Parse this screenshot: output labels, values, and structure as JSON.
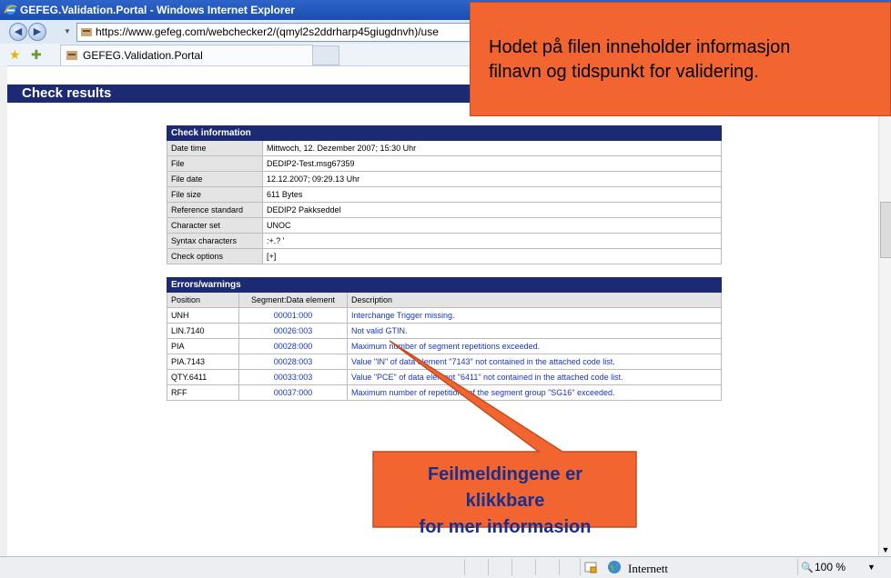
{
  "window": {
    "title": "GEFEG.Validation.Portal - Windows Internet Explorer"
  },
  "address": {
    "url": "https://www.gefeg.com/webchecker2/(qmyl2s2ddrharp45giugdnvh)/use"
  },
  "tab": {
    "label": "GEFEG.Validation.Portal"
  },
  "page": {
    "heading": "Check results"
  },
  "check_info": {
    "caption": "Check information",
    "rows": [
      {
        "label": "Date time",
        "value": "Mittwoch, 12. Dezember 2007; 15:30 Uhr"
      },
      {
        "label": "File",
        "value": "DEDIP2-Test.msg67359"
      },
      {
        "label": "File date",
        "value": "12.12.2007; 09:29.13 Uhr"
      },
      {
        "label": "File size",
        "value": "611 Bytes"
      },
      {
        "label": "Reference standard",
        "value": "DEDIP2 Pakkseddel"
      },
      {
        "label": "Character set",
        "value": "UNOC"
      },
      {
        "label": "Syntax characters",
        "value": ":+.? '"
      },
      {
        "label": "Check options",
        "value": "[+]"
      }
    ]
  },
  "errors": {
    "caption": "Errors/warnings",
    "headers": {
      "position": "Position",
      "segment": "Segment:Data element",
      "description": "Description"
    },
    "rows": [
      {
        "position": "UNH",
        "segment": "00001:000",
        "description": "Interchange Trigger missing."
      },
      {
        "position": "LIN.7140",
        "segment": "00026:003",
        "description": "Not valid GTIN."
      },
      {
        "position": "PIA",
        "segment": "00028:000",
        "description": "Maximum number of segment repetitions exceeded."
      },
      {
        "position": "PIA.7143",
        "segment": "00028:003",
        "description": "Value \"IN\" of data element \"7143\" not contained in the attached code list."
      },
      {
        "position": "QTY.6411",
        "segment": "00033:003",
        "description": "Value \"PCE\" of data element \"6411\" not contained in the attached code list."
      },
      {
        "position": "RFF",
        "segment": "00037:000",
        "description": "Maximum number of repetitions of the segment group \"SG16\" exceeded."
      }
    ]
  },
  "callouts": {
    "top_line1": "Hodet på filen inneholder informasjon",
    "top_line2": "filnavn og tidspunkt for validering.",
    "bottom_line1": "Feilmeldingene er klikkbare",
    "bottom_line2": "for mer informasion"
  },
  "status": {
    "zone": "Internett",
    "zoom": "100 %"
  },
  "colors": {
    "header_navy": "#1c2a73",
    "callout_orange": "#f26531",
    "link_blue": "#1a36c8",
    "callout_text_blue": "#1a2f8c"
  }
}
